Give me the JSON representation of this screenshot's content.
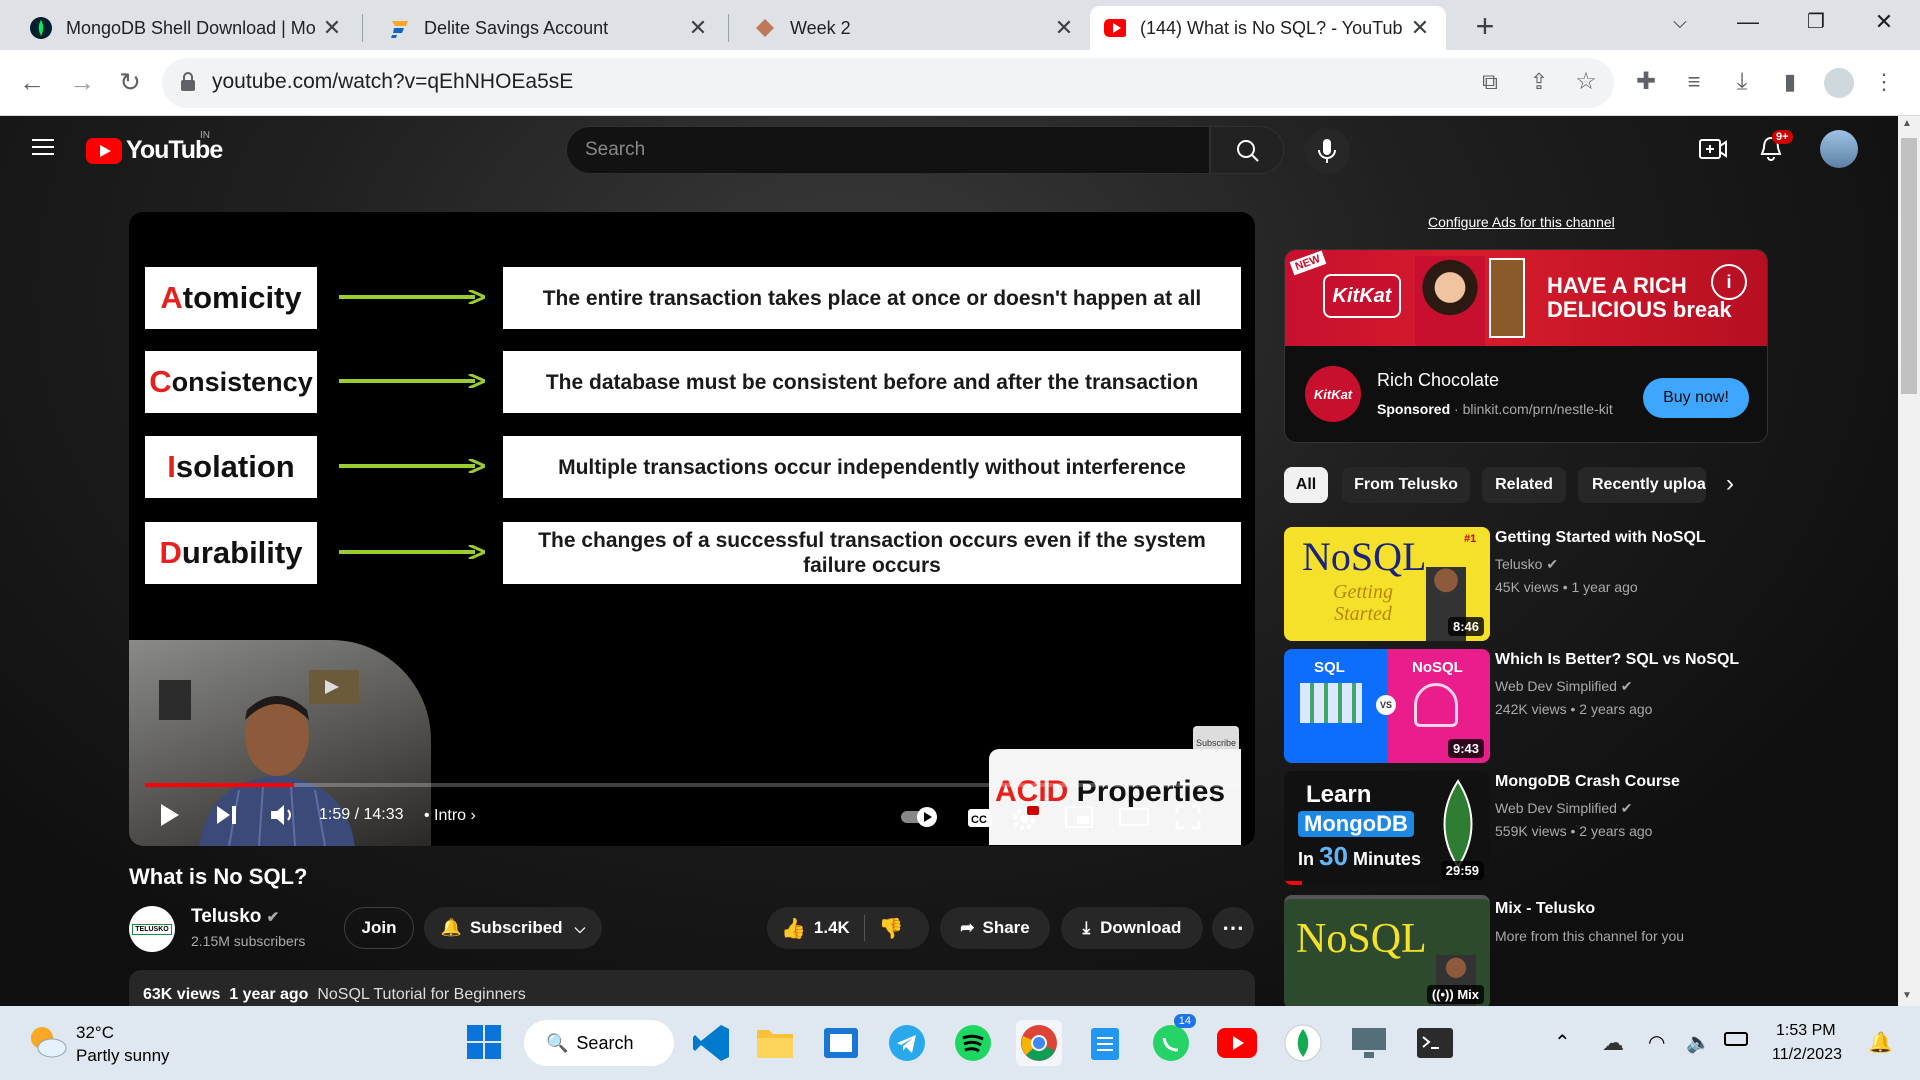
{
  "browser": {
    "tabs": [
      {
        "title": "MongoDB Shell Download | Mo",
        "active": false
      },
      {
        "title": "Delite Savings Account",
        "active": false
      },
      {
        "title": "Week 2",
        "active": false
      },
      {
        "title": "(144) What is No SQL? - YouTub",
        "active": true
      }
    ],
    "new_tab": "+",
    "url": "youtube.com/watch?v=qEhNHOEa5sE"
  },
  "youtube": {
    "logo_text": "YouTube",
    "country": "IN",
    "search_placeholder": "Search",
    "notifications_count": "9+"
  },
  "player": {
    "slide": [
      {
        "first": "A",
        "rest": "tomicity",
        "desc": "The entire transaction takes place at once or doesn't happen at all"
      },
      {
        "first": "C",
        "rest": "onsistency",
        "desc": "The database must be consistent before and after the transaction"
      },
      {
        "first": "I",
        "rest": "solation",
        "desc": "Multiple transactions occur independently without interference"
      },
      {
        "first": "D",
        "rest": "urability",
        "desc": "The changes of a successful transaction occurs even if the system failure occurs"
      }
    ],
    "time": "1:59 / 14:33",
    "chapter": "Intro",
    "progress_fraction": 0.136,
    "end_card_first": "ACID",
    "end_card_rest": " Properties",
    "subscribe_badge": "Subscribe Telusko"
  },
  "video": {
    "title": "What is No SQL?",
    "channel": "Telusko",
    "channel_logo_text": "TELUSKO",
    "subscribers": "2.15M subscribers",
    "join_label": "Join",
    "subscribed_label": "Subscribed",
    "likes": "1.4K",
    "share_label": "Share",
    "download_label": "Download",
    "views": "63K views",
    "age": "1 year ago",
    "hashtag": "NoSQL Tutorial for Beginners"
  },
  "ad": {
    "configure_link": "Configure Ads for this channel",
    "banner_text_1": "HAVE A RICH",
    "banner_text_2": "DELICIOUS break",
    "banner_new": "NEW",
    "logo_text": "KitKat",
    "title": "Rich Chocolate",
    "sponsored": "Sponsored",
    "domain": "blinkit.com/prn/nestle-kit",
    "cta": "Buy now!"
  },
  "chips": [
    "All",
    "From Telusko",
    "Related",
    "Recently uploa"
  ],
  "recommendations": [
    {
      "title": "Getting Started with NoSQL",
      "channel": "Telusko",
      "views": "45K views",
      "age": "1 year ago",
      "duration": "8:46",
      "thumb_text": "NoSQL",
      "thumb_sub": "Getting Started",
      "thumb_badge": "#1"
    },
    {
      "title": "Which Is Better? SQL vs NoSQL",
      "channel": "Web Dev Simplified",
      "views": "242K views",
      "age": "2 years ago",
      "duration": "9:43",
      "thumb_left": "SQL",
      "thumb_right": "NoSQL",
      "thumb_vs": "VS"
    },
    {
      "title": "MongoDB Crash Course",
      "channel": "Web Dev Simplified",
      "views": "559K views",
      "age": "2 years ago",
      "duration": "29:59",
      "thumb_line1": "Learn",
      "thumb_line2": "MongoDB",
      "thumb_line3_num": "30",
      "thumb_line3": "Minutes",
      "thumb_line3_pre": "In"
    },
    {
      "title": "Mix - Telusko",
      "channel": "More from this channel for you",
      "duration": "Mix",
      "thumb_text": "NoSQL"
    }
  ],
  "taskbar": {
    "temperature": "32°C",
    "weather": "Partly sunny",
    "search_label": "Search",
    "whatsapp_badge": "14",
    "time": "1:53 PM",
    "date": "11/2/2023"
  },
  "colors": {
    "youtube_red": "#ff0000",
    "acid_red": "#e8201c",
    "arrow_green": "#9acd32",
    "link_blue": "#3ea6ff"
  }
}
